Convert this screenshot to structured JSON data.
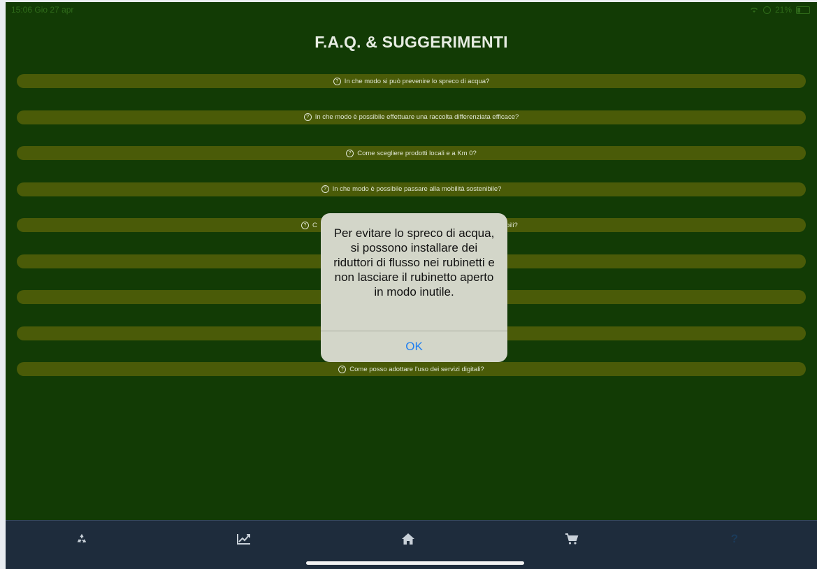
{
  "status_bar": {
    "time": "15:06",
    "date": "Gio 27 apr",
    "battery": "21%"
  },
  "page": {
    "title": "F.A.Q. & SUGGERIMENTI"
  },
  "faq": [
    {
      "question": "In che modo si può prevenire lo spreco di acqua?"
    },
    {
      "question": "In che modo è possibile effettuare una raccolta differenziata efficace?"
    },
    {
      "question": "Come scegliere prodotti locali e a Km 0?"
    },
    {
      "question": "In che modo è possibile passare alla mobilità sostenibile?"
    },
    {
      "question_left": "C",
      "question_right": "bili?"
    },
    {
      "question": ""
    },
    {
      "question": ""
    },
    {
      "question": ""
    },
    {
      "question": "Come posso adottare l'uso dei servizi digitali?"
    }
  ],
  "alert": {
    "message": "Per evitare lo spreco di acqua, si possono installare dei riduttori di flusso nei rubinetti e non lasciare il rubinetto aperto in modo inutile.",
    "ok_label": "OK"
  },
  "tabbar": {
    "tabs": [
      {
        "icon": "recycle-icon"
      },
      {
        "icon": "chart-line-icon"
      },
      {
        "icon": "home-icon"
      },
      {
        "icon": "cart-icon"
      },
      {
        "icon": "question-icon",
        "label": "?"
      }
    ]
  },
  "colors": {
    "background": "#123b05",
    "faq_item": "#4a5b08",
    "tabbar": "#1e2c3c",
    "accent": "#1f7ff0",
    "active_tab": "#1b3b5a"
  }
}
